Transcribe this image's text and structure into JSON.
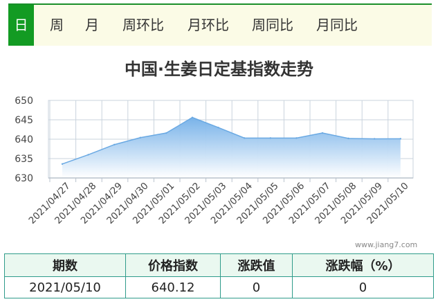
{
  "tabs": [
    {
      "label": "日",
      "active": true
    },
    {
      "label": "周",
      "active": false
    },
    {
      "label": "月",
      "active": false
    },
    {
      "label": "周环比",
      "active": false
    },
    {
      "label": "月环比",
      "active": false
    },
    {
      "label": "周同比",
      "active": false
    },
    {
      "label": "月同比",
      "active": false
    }
  ],
  "watermark": "www.jiang7.com",
  "colors": {
    "tab_active": "#139b23",
    "tab_bar_top": "#1a8f2a",
    "tab_bar_bg": "#fbfbe6",
    "area_top": "#72afe8",
    "area_bottom": "#ffffff",
    "line": "#6aa9e3",
    "grid": "#c9d3dd",
    "table_border": "#2e9b8a",
    "table_header_bg": "#eaf8f0"
  },
  "chart_data": {
    "type": "area",
    "title": "中国·生姜日定基指数走势",
    "xlabel": "",
    "ylabel": "",
    "ylim": [
      630,
      650
    ],
    "yticks": [
      "650",
      "645",
      "640",
      "635",
      "630"
    ],
    "grid": true,
    "categories": [
      "2021/04/27",
      "2021/04/28",
      "2021/04/29",
      "2021/04/30",
      "2021/05/01",
      "2021/05/02",
      "2021/05/03",
      "2021/05/04",
      "2021/05/05",
      "2021/05/06",
      "2021/05/07",
      "2021/05/08",
      "2021/05/09",
      "2021/05/10"
    ],
    "values": [
      633.6,
      636.0,
      638.6,
      640.4,
      641.6,
      645.6,
      643.0,
      640.3,
      640.3,
      640.3,
      641.6,
      640.2,
      640.1,
      640.12
    ]
  },
  "summary": {
    "headers": [
      "期数",
      "价格指数",
      "涨跌值",
      "涨跌幅（%）"
    ],
    "row": [
      "2021/05/10",
      "640.12",
      "0",
      "0"
    ]
  }
}
